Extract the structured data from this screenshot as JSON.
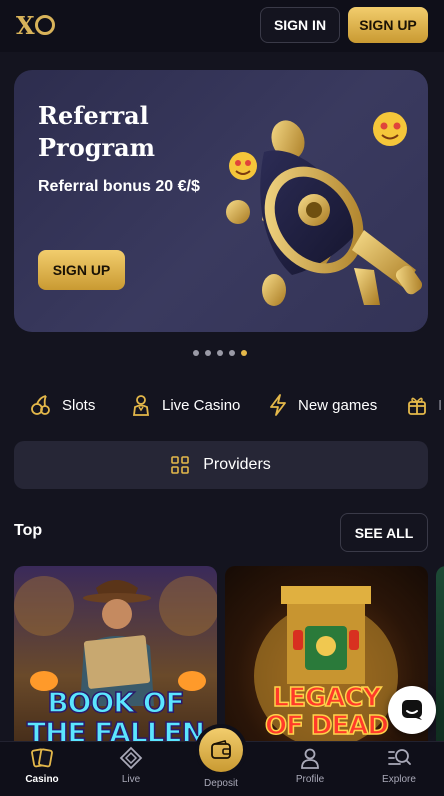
{
  "header": {
    "logo_text": "XO",
    "sign_in_label": "SIGN IN",
    "sign_up_label": "SIGN UP"
  },
  "banner": {
    "title": "Referral Program",
    "subtitle": "Referral bonus 20 €/$",
    "button_label": "SIGN UP",
    "slides_total": 5,
    "active_slide": 5
  },
  "categories": [
    {
      "label": "Slots",
      "icon": "cherries-icon"
    },
    {
      "label": "Live Casino",
      "icon": "dealer-icon"
    },
    {
      "label": "New games",
      "icon": "lightning-icon"
    },
    {
      "label": "I",
      "icon": "gift-icon"
    }
  ],
  "providers": {
    "label": "Providers",
    "icon": "grid-icon"
  },
  "top_section": {
    "title": "Top",
    "see_all_label": "SEE ALL",
    "games": [
      {
        "name_line1": "BOOK OF",
        "name_line2": "THE FALLEN"
      },
      {
        "name_line1": "LEGACY",
        "name_line2": "OF DEAD"
      }
    ]
  },
  "bottom_nav": {
    "items": [
      {
        "label": "Casino",
        "icon": "cards-icon",
        "active": true
      },
      {
        "label": "Live",
        "icon": "chip-icon",
        "active": false
      },
      {
        "label": "Deposit",
        "icon": "wallet-icon",
        "active": false
      },
      {
        "label": "Profile",
        "icon": "user-icon",
        "active": false
      },
      {
        "label": "Explore",
        "icon": "search-list-icon",
        "active": false
      }
    ]
  },
  "colors": {
    "background": "#14141f",
    "accent_gold": "#e4b84a",
    "banner_bg": "#333356"
  }
}
